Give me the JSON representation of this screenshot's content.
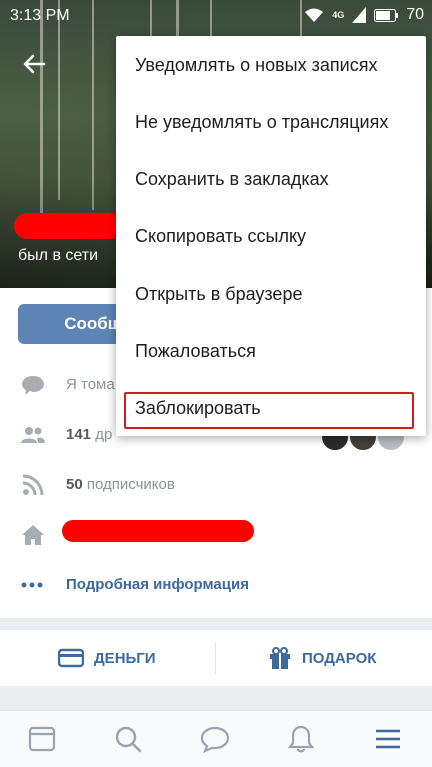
{
  "status_bar": {
    "time": "3:13 PM",
    "network": "4G",
    "battery": "70"
  },
  "profile": {
    "status_text": "был в сети",
    "message_button": "Сообщение",
    "about_text": "Я тома",
    "friends_count": "141",
    "friends_label": "др",
    "followers_count": "50",
    "followers_label": "подписчиков",
    "more_info": "Подробная информация"
  },
  "actions": {
    "money": "ДЕНЬГИ",
    "gift": "ПОДАРОК"
  },
  "menu": {
    "items": [
      "Уведомлять о новых записях",
      "Не уведомлять о трансляциях",
      "Сохранить в закладках",
      "Скопировать ссылку",
      "Открыть в браузере",
      "Пожаловаться",
      "Заблокировать"
    ]
  },
  "colors": {
    "accent": "#3d6a9c",
    "button": "#5d84b5",
    "highlight": "#d51b1b",
    "redaction": "#ff0000"
  },
  "icons": {
    "nav": [
      "newsfeed-icon",
      "search-icon",
      "messages-icon",
      "notifications-icon",
      "menu-icon"
    ]
  }
}
